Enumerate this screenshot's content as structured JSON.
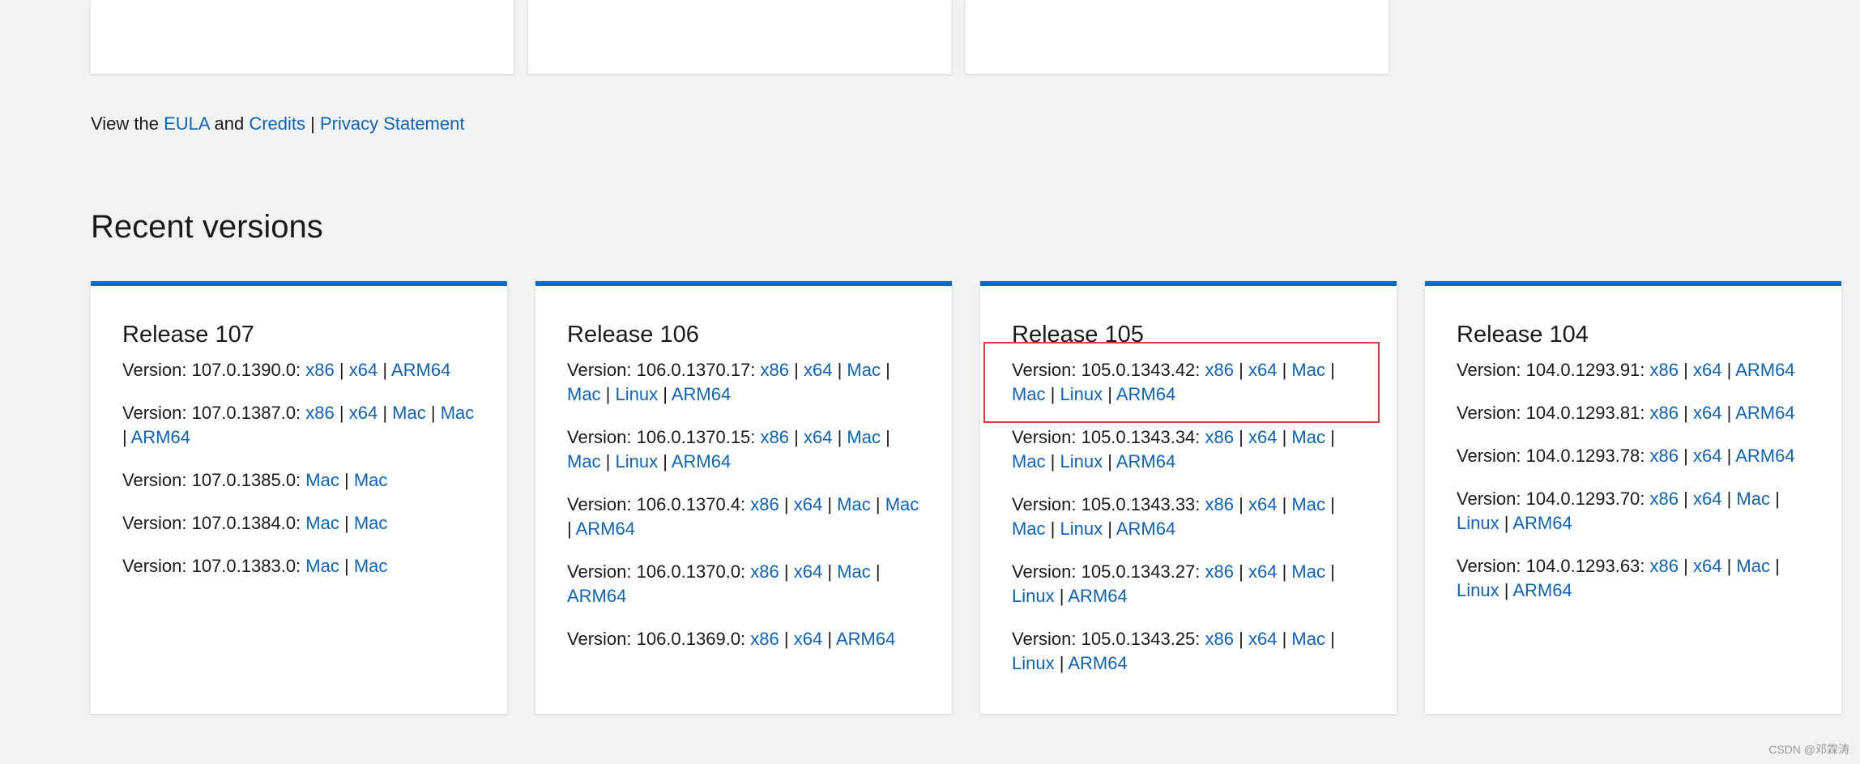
{
  "legal": {
    "prefix": "View the ",
    "eula": "EULA",
    "and": " and ",
    "credits": "Credits",
    "sep": " | ",
    "privacy": "Privacy Statement"
  },
  "section_title": "Recent versions",
  "releases": [
    {
      "title": "Release 107",
      "versions": [
        {
          "label": "Version: 107.0.1390.0:",
          "links": [
            "x86",
            "x64",
            "ARM64"
          ]
        },
        {
          "label": "Version: 107.0.1387.0:",
          "links": [
            "x86",
            "x64",
            "Mac",
            "Mac",
            "ARM64"
          ]
        },
        {
          "label": "Version: 107.0.1385.0:",
          "links": [
            "Mac",
            "Mac"
          ]
        },
        {
          "label": "Version: 107.0.1384.0:",
          "links": [
            "Mac",
            "Mac"
          ]
        },
        {
          "label": "Version: 107.0.1383.0:",
          "links": [
            "Mac",
            "Mac"
          ]
        }
      ]
    },
    {
      "title": "Release 106",
      "versions": [
        {
          "label": "Version: 106.0.1370.17:",
          "links": [
            "x86",
            "x64",
            "Mac",
            "Mac",
            "Linux",
            "ARM64"
          ]
        },
        {
          "label": "Version: 106.0.1370.15:",
          "links": [
            "x86",
            "x64",
            "Mac",
            "Mac",
            "Linux",
            "ARM64"
          ]
        },
        {
          "label": "Version: 106.0.1370.4:",
          "links": [
            "x86",
            "x64",
            "Mac",
            "Mac",
            "ARM64"
          ]
        },
        {
          "label": "Version: 106.0.1370.0:",
          "links": [
            "x86",
            "x64",
            "Mac",
            "ARM64"
          ]
        },
        {
          "label": "Version: 106.0.1369.0:",
          "links": [
            "x86",
            "x64",
            "ARM64"
          ]
        }
      ]
    },
    {
      "title": "Release 105",
      "versions": [
        {
          "label": "Version: 105.0.1343.42:",
          "links": [
            "x86",
            "x64",
            "Mac",
            "Mac",
            "Linux",
            "ARM64"
          ],
          "highlight": true
        },
        {
          "label": "Version: 105.0.1343.34:",
          "links": [
            "x86",
            "x64",
            "Mac",
            "Mac",
            "Linux",
            "ARM64"
          ]
        },
        {
          "label": "Version: 105.0.1343.33:",
          "links": [
            "x86",
            "x64",
            "Mac",
            "Mac",
            "Linux",
            "ARM64"
          ]
        },
        {
          "label": "Version: 105.0.1343.27:",
          "links": [
            "x86",
            "x64",
            "Mac",
            "Linux",
            "ARM64"
          ]
        },
        {
          "label": "Version: 105.0.1343.25:",
          "links": [
            "x86",
            "x64",
            "Mac",
            "Linux",
            "ARM64"
          ]
        }
      ]
    },
    {
      "title": "Release 104",
      "versions": [
        {
          "label": "Version: 104.0.1293.91:",
          "links": [
            "x86",
            "x64",
            "ARM64"
          ]
        },
        {
          "label": "Version: 104.0.1293.81:",
          "links": [
            "x86",
            "x64",
            "ARM64"
          ]
        },
        {
          "label": "Version: 104.0.1293.78:",
          "links": [
            "x86",
            "x64",
            "ARM64"
          ]
        },
        {
          "label": "Version: 104.0.1293.70:",
          "links": [
            "x86",
            "x64",
            "Mac",
            "Linux",
            "ARM64"
          ]
        },
        {
          "label": "Version: 104.0.1293.63:",
          "links": [
            "x86",
            "x64",
            "Mac",
            "Linux",
            "ARM64"
          ]
        }
      ]
    }
  ],
  "watermark": "CSDN @邓霖涛",
  "colors": {
    "link": "#0f63b7",
    "accent_border": "#0f6cbd",
    "highlight_box": "#e23a3a",
    "background": "#f2f2f2"
  }
}
